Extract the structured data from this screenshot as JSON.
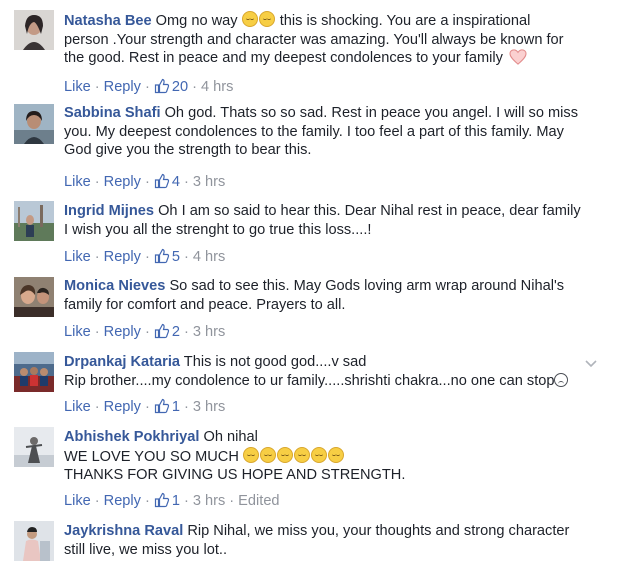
{
  "colors": {
    "author": "#365899",
    "link": "#4267b2",
    "meta": "#90949c",
    "text": "#1d2129"
  },
  "actions": {
    "like": "Like",
    "reply": "Reply",
    "sep": "·"
  },
  "comments": [
    {
      "author": "Natasha Bee",
      "line1_a": "Omg no way",
      "line1_b": "this is shocking. You are a inspirational",
      "line2": "person .Your strength and character was amazing. You'll always be known for",
      "line3": "the good. Rest in peace and my deepest condolences to your family",
      "likes": "20",
      "time": "4 hrs",
      "avatar_icon": "profile-photo"
    },
    {
      "author": "Sabbina Shafi",
      "line1": "Oh god. Thats so so sad. Rest in peace you angel. I will so miss",
      "line2": "you. My deepest condolences to the family. I too feel a part of this family. May",
      "line3": "God give you the strength to bear this.",
      "likes": "4",
      "time": "3 hrs",
      "avatar_icon": "profile-photo"
    },
    {
      "author": "Ingrid Mijnes",
      "line1": "Oh I am so said to hear this. Dear Nihal rest in peace, dear family",
      "line2": "I wish you all the strenght to go true this loss....!",
      "likes": "5",
      "time": "4 hrs",
      "avatar_icon": "profile-photo"
    },
    {
      "author": "Monica Nieves",
      "line1": "So sad to see this. May Gods loving arm wrap around Nihal's",
      "line2": "family for comfort and peace. Prayers to all.",
      "likes": "2",
      "time": "3 hrs",
      "avatar_icon": "profile-photo"
    },
    {
      "author": "Drpankaj Kataria",
      "line1": "This is not good god....v sad",
      "line2": "Rip brother....my condolence to ur family.....shrishti chakra...no one can stop",
      "likes": "1",
      "time": "3 hrs",
      "avatar_icon": "profile-photo"
    },
    {
      "author": "Abhishek Pokhriyal",
      "line1": "Oh nihal",
      "line2": "WE LOVE YOU SO MUCH",
      "line3": "THANKS FOR GIVING US HOPE AND STRENGTH.",
      "likes": "1",
      "time": "3 hrs",
      "edited": "Edited",
      "avatar_icon": "profile-photo"
    },
    {
      "author": "Jaykrishna Raval",
      "line1": "Rip Nihal, we miss you, your thoughts and strong character",
      "line2": "still live, we miss you lot..",
      "avatar_icon": "profile-photo"
    }
  ]
}
